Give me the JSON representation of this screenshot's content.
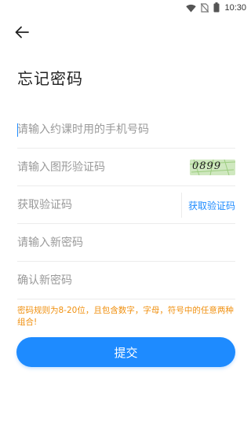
{
  "status_bar": {
    "time": "10:30",
    "icons": [
      "wifi-icon",
      "no-sim-icon",
      "battery-icon"
    ]
  },
  "header": {
    "back_icon": "arrow-left-icon",
    "title": "忘记密码"
  },
  "form": {
    "phone_placeholder": "请输入约课时用的手机号码",
    "captcha_placeholder": "请输入图形验证码",
    "captcha_image_text": "0899",
    "sms_code_placeholder": "获取验证码",
    "sms_button_label": "获取验证码",
    "new_password_placeholder": "请输入新密码",
    "confirm_password_placeholder": "确认新密码"
  },
  "hint": "密码规则为8-20位，且包含数字，字母，符号中的任意两种组合!",
  "submit_label": "提交",
  "colors": {
    "accent": "#1e8bff",
    "hint": "#f0900f",
    "captcha_bg": "#cfe8bf"
  }
}
